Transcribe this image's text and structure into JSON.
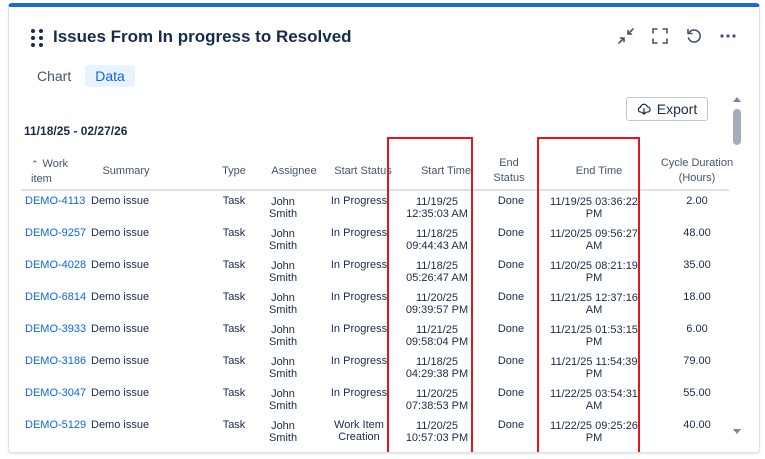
{
  "widget": {
    "title": "Issues From In progress to Resolved",
    "actions": [
      {
        "name": "collapse-icon"
      },
      {
        "name": "fullscreen-icon"
      },
      {
        "name": "refresh-icon"
      },
      {
        "name": "more-icon"
      }
    ]
  },
  "tabs": [
    {
      "label": "Chart",
      "active": false
    },
    {
      "label": "Data",
      "active": true
    }
  ],
  "toolbar": {
    "export_label": "Export"
  },
  "date_range": "11/18/25 - 02/27/26",
  "table": {
    "headers": {
      "work_item": "Work item",
      "summary": "Summary",
      "type": "Type",
      "assignee": "Assignee",
      "start_status": "Start Status",
      "start_time": "Start Time",
      "end_status": "End Status",
      "end_time": "End Time",
      "cycle_duration": "Cycle Duration (Hours)"
    },
    "rows": [
      {
        "key": "DEMO-4113",
        "summary": "Demo issue",
        "type": "Task",
        "assignee": "John Smith",
        "start_status": "In Progress",
        "start_time": "11/19/25 12:35:03 AM",
        "end_status": "Done",
        "end_time": "11/19/25 03:36:22 PM",
        "duration": "2.00"
      },
      {
        "key": "DEMO-9257",
        "summary": "Demo issue",
        "type": "Task",
        "assignee": "John Smith",
        "start_status": "In Progress",
        "start_time": "11/18/25 09:44:43 AM",
        "end_status": "Done",
        "end_time": "11/20/25 09:56:27 AM",
        "duration": "48.00"
      },
      {
        "key": "DEMO-4028",
        "summary": "Demo issue",
        "type": "Task",
        "assignee": "John Smith",
        "start_status": "In Progress",
        "start_time": "11/18/25 05:26:47 AM",
        "end_status": "Done",
        "end_time": "11/20/25 08:21:19 PM",
        "duration": "35.00"
      },
      {
        "key": "DEMO-6814",
        "summary": "Demo issue",
        "type": "Task",
        "assignee": "John Smith",
        "start_status": "In Progress",
        "start_time": "11/20/25 09:39:57 PM",
        "end_status": "Done",
        "end_time": "11/21/25 12:37:16 AM",
        "duration": "18.00"
      },
      {
        "key": "DEMO-3933",
        "summary": "Demo issue",
        "type": "Task",
        "assignee": "John Smith",
        "start_status": "In Progress",
        "start_time": "11/21/25 09:58:04 PM",
        "end_status": "Done",
        "end_time": "11/21/25 01:53:15 PM",
        "duration": "6.00"
      },
      {
        "key": "DEMO-3186",
        "summary": "Demo issue",
        "type": "Task",
        "assignee": "John Smith",
        "start_status": "In Progress",
        "start_time": "11/18/25 04:29:38 PM",
        "end_status": "Done",
        "end_time": "11/21/25 11:54:39 PM",
        "duration": "79.00"
      },
      {
        "key": "DEMO-3047",
        "summary": "Demo issue",
        "type": "Task",
        "assignee": "John Smith",
        "start_status": "In Progress",
        "start_time": "11/20/25 07:38:53 PM",
        "end_status": "Done",
        "end_time": "11/22/25 03:54:31 AM",
        "duration": "55.00"
      },
      {
        "key": "DEMO-5129",
        "summary": "Demo issue",
        "type": "Task",
        "assignee": "John Smith",
        "start_status": "Work Item Creation",
        "start_time": "11/20/25 10:57:03 PM",
        "end_status": "Done",
        "end_time": "11/22/25 09:25:26 PM",
        "duration": "40.00"
      }
    ]
  },
  "annotation_color": "#e3161b"
}
